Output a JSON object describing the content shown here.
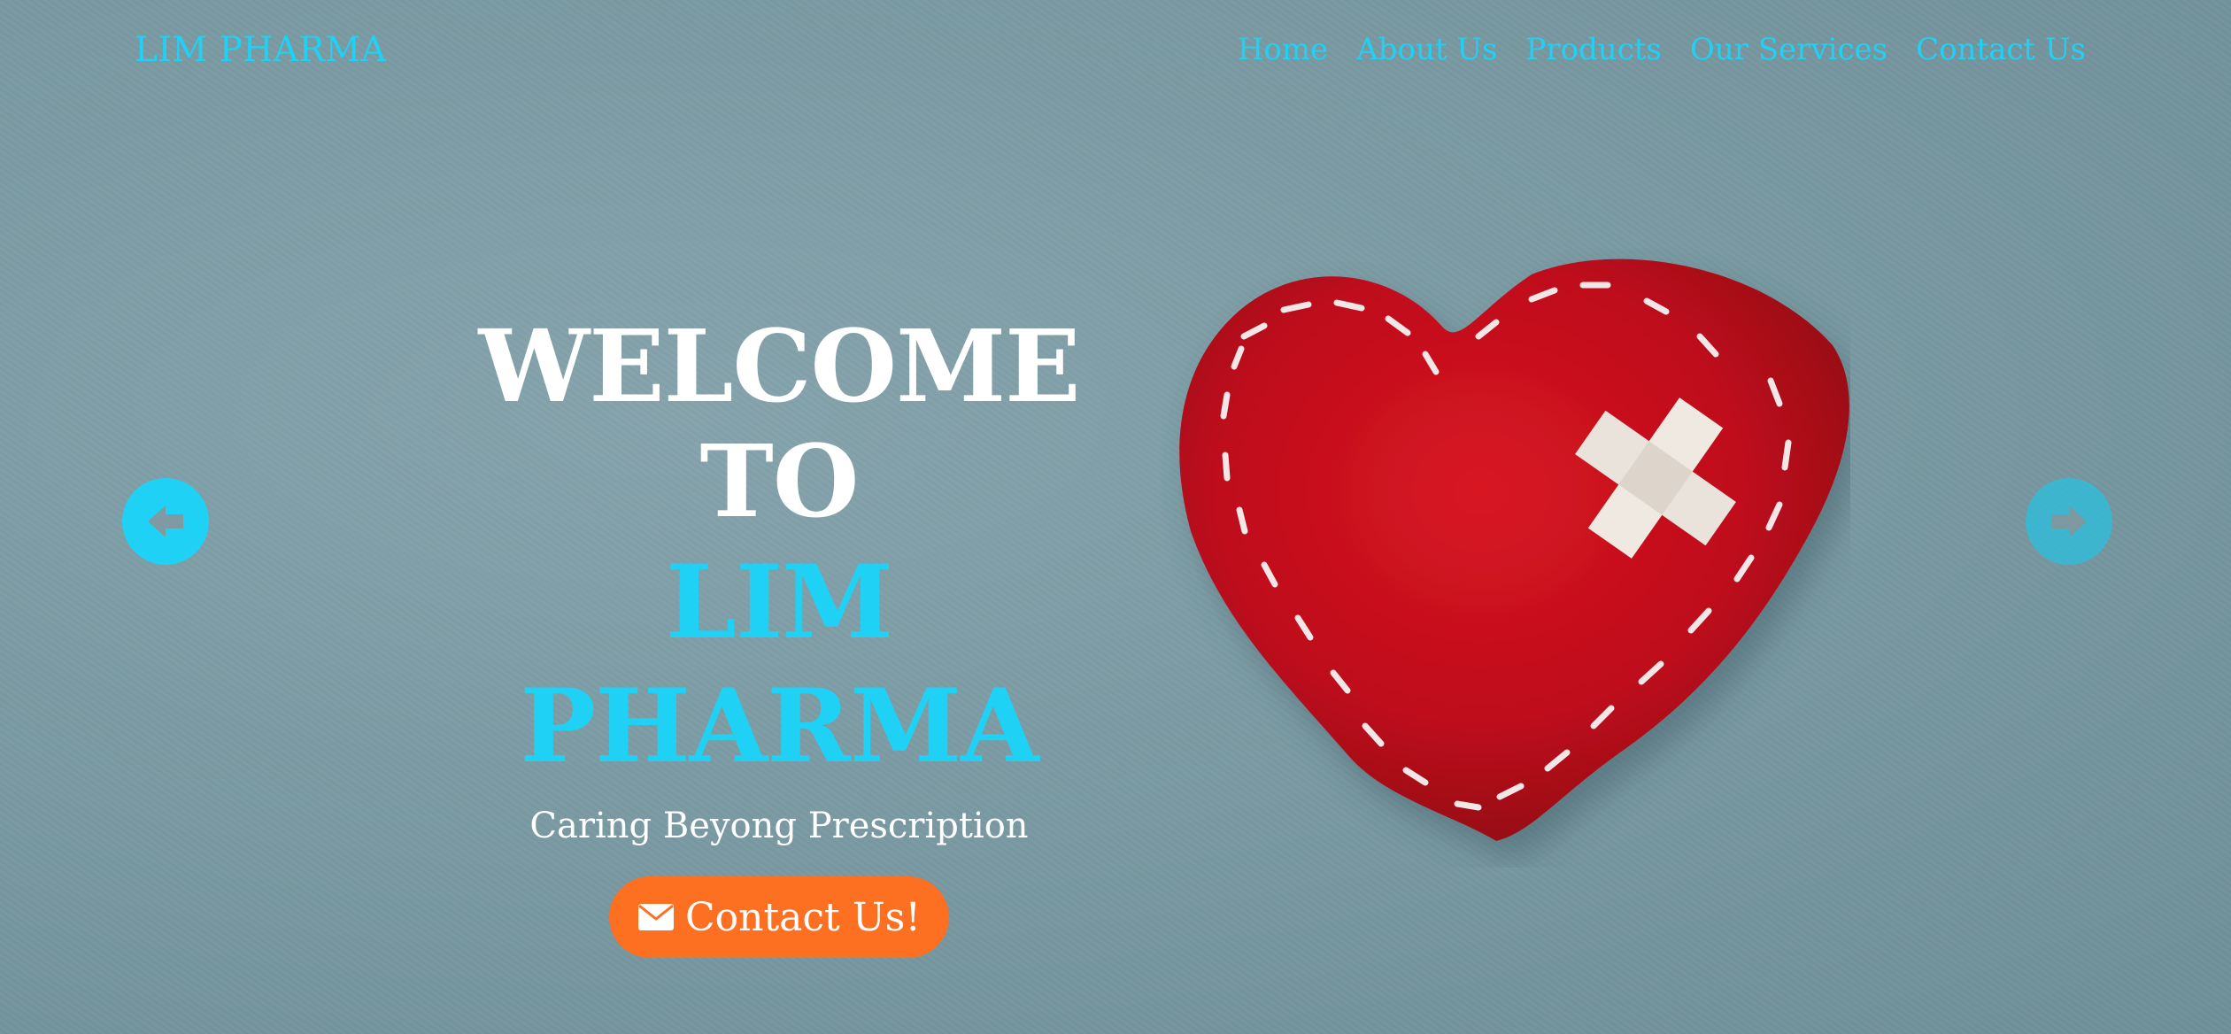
{
  "navbar": {
    "brand": "LIM PHARMA",
    "links": [
      "Home",
      "About Us",
      "Products",
      "Our Services",
      "Contact Us"
    ]
  },
  "hero": {
    "heading_line1": "WELCOME TO",
    "heading_line2": "LIM PHARMA",
    "tagline": "Caring Beyong Prescription",
    "cta_label": "Contact Us!",
    "cta_icon": "envelope-icon"
  },
  "carousel": {
    "prev_icon": "arrow-left-circle-icon",
    "next_icon": "arrow-right-circle-icon"
  },
  "colors": {
    "accent": "#1fd2f5",
    "cta": "#fd6f21",
    "background": "#7b9aa3",
    "heart": "#c8101e"
  }
}
